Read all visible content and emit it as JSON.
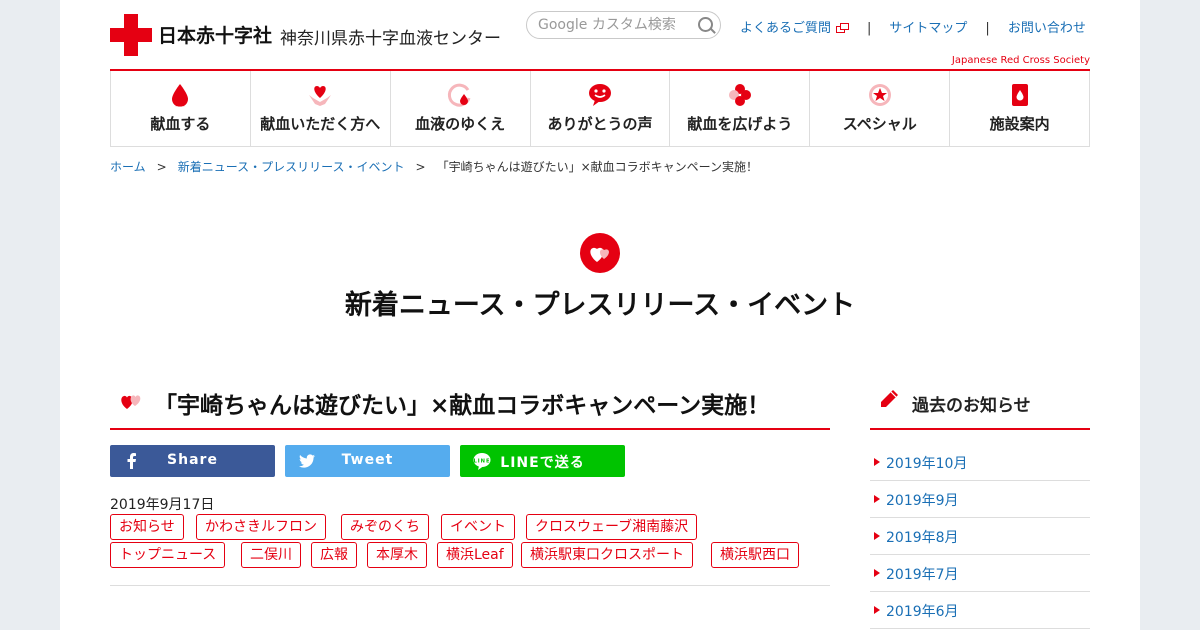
{
  "header": {
    "org_name": "日本赤十字社",
    "center_name": "神奈川県赤十字血液センター",
    "search_placeholder": "Google カスタム検索",
    "links": [
      "よくあるご質問",
      "サイトマップ",
      "お問い合わせ"
    ],
    "separator": "|",
    "society_en": "Japanese Red Cross Society"
  },
  "nav": {
    "items": [
      {
        "label": "献血する",
        "icon": "blood-drop-icon"
      },
      {
        "label": "献血いただく方へ",
        "icon": "heart-hands-icon"
      },
      {
        "label": "血液のゆくえ",
        "icon": "cycle-drop-icon"
      },
      {
        "label": "ありがとうの声",
        "icon": "smile-bubble-icon"
      },
      {
        "label": "献血を広げよう",
        "icon": "clover-icon"
      },
      {
        "label": "スペシャル",
        "icon": "star-badge-icon"
      },
      {
        "label": "施設案内",
        "icon": "building-drop-icon"
      }
    ]
  },
  "breadcrumb": {
    "home": "ホーム",
    "section": "新着ニュース・プレスリリース・イベント",
    "current": "「宇崎ちゃんは遊びたい」×献血コラボキャンペーン実施！",
    "sep": ">"
  },
  "section_title": "新着ニュース・プレスリリース・イベント",
  "article": {
    "title": "「宇崎ちゃんは遊びたい」×献血コラボキャンペーン実施！",
    "share": {
      "facebook": "Share",
      "twitter": "Tweet",
      "line": "LINEで送る"
    },
    "date": "2019年9月17日",
    "tags": [
      "お知らせ",
      "かわさきルフロン",
      "みぞのくち",
      "イベント",
      "クロスウェーブ湘南藤沢",
      "トップニュース",
      "二俣川",
      "広報",
      "本厚木",
      "横浜Leaf",
      "横浜駅東口クロスポート",
      "横浜駅西口"
    ]
  },
  "sidebar": {
    "title": "過去のお知らせ",
    "items": [
      "2019年10月",
      "2019年9月",
      "2019年8月",
      "2019年7月",
      "2019年6月"
    ]
  },
  "colors": {
    "accent": "#e50012",
    "link": "#1a6fb5",
    "facebook": "#3b5998",
    "twitter": "#55acee",
    "line": "#00c300"
  }
}
